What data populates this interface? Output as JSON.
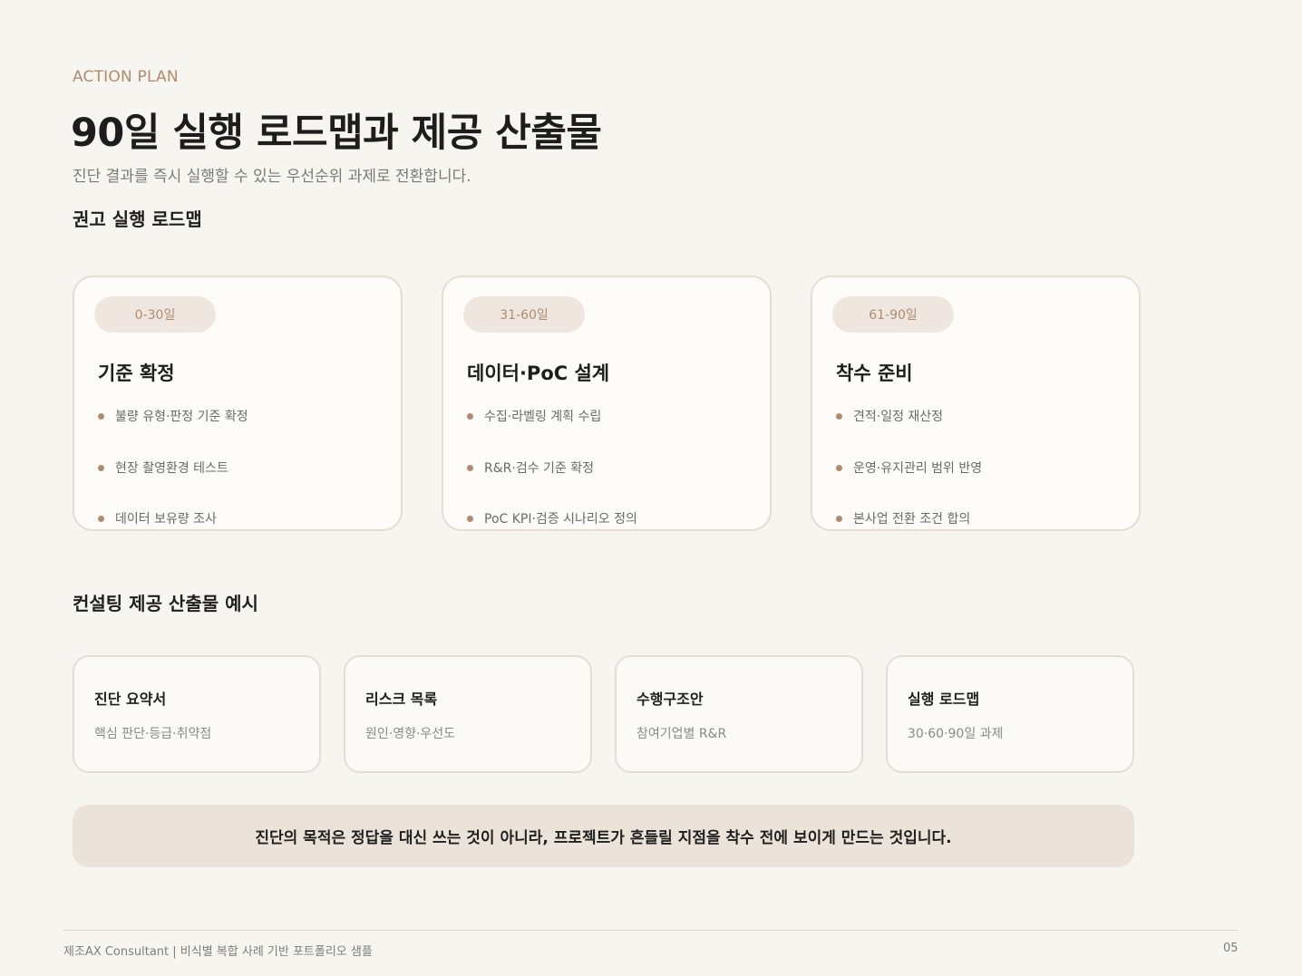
{
  "header": {
    "eyebrow": "ACTION PLAN",
    "title": "90일 실행 로드맵과 제공 산출물",
    "subtitle": "진단 결과를 즉시 실행할 수 있는 우선순위 과제로 전환합니다."
  },
  "roadmap": {
    "heading": "권고 실행 로드맵",
    "phases": [
      {
        "period": "0-30일",
        "title": "기준 확정",
        "items": [
          "불량 유형·판정 기준 확정",
          "현장 촬영환경 테스트",
          "데이터 보유량 조사"
        ]
      },
      {
        "period": "31-60일",
        "title": "데이터·PoC 설계",
        "items": [
          "수집·라벨링 계획 수립",
          "R&R·검수 기준 확정",
          "PoC KPI·검증 시나리오 정의"
        ]
      },
      {
        "period": "61-90일",
        "title": "착수 준비",
        "items": [
          "견적·일정 재산정",
          "운영·유지관리 범위 반영",
          "본사업 전환 조건 합의"
        ]
      }
    ]
  },
  "deliverables": {
    "heading": "컨설팅 제공 산출물 예시",
    "cards": [
      {
        "title": "진단 요약서",
        "desc": "핵심 판단·등급·취약점"
      },
      {
        "title": "리스크 목록",
        "desc": "원인·영향·우선도"
      },
      {
        "title": "수행구조안",
        "desc": "참여기업별 R&R"
      },
      {
        "title": "실행 로드맵",
        "desc": "30·60·90일 과제"
      }
    ]
  },
  "banner": {
    "text": "진단의 목적은 정답을 대신 쓰는 것이 아니라, 프로젝트가 흔들릴 지점을 착수 전에 보이게 만드는 것입니다."
  },
  "footer": {
    "left": "제조AX Consultant | 비식별 복합 사례 기반 포트폴리오 샘플",
    "page": "05"
  },
  "colors": {
    "background": "#f7f5f0",
    "accent": "#b08b70",
    "card_border": "#e4ddd3",
    "pill_bg": "#efe7df",
    "banner_bg": "#ebe3da"
  }
}
